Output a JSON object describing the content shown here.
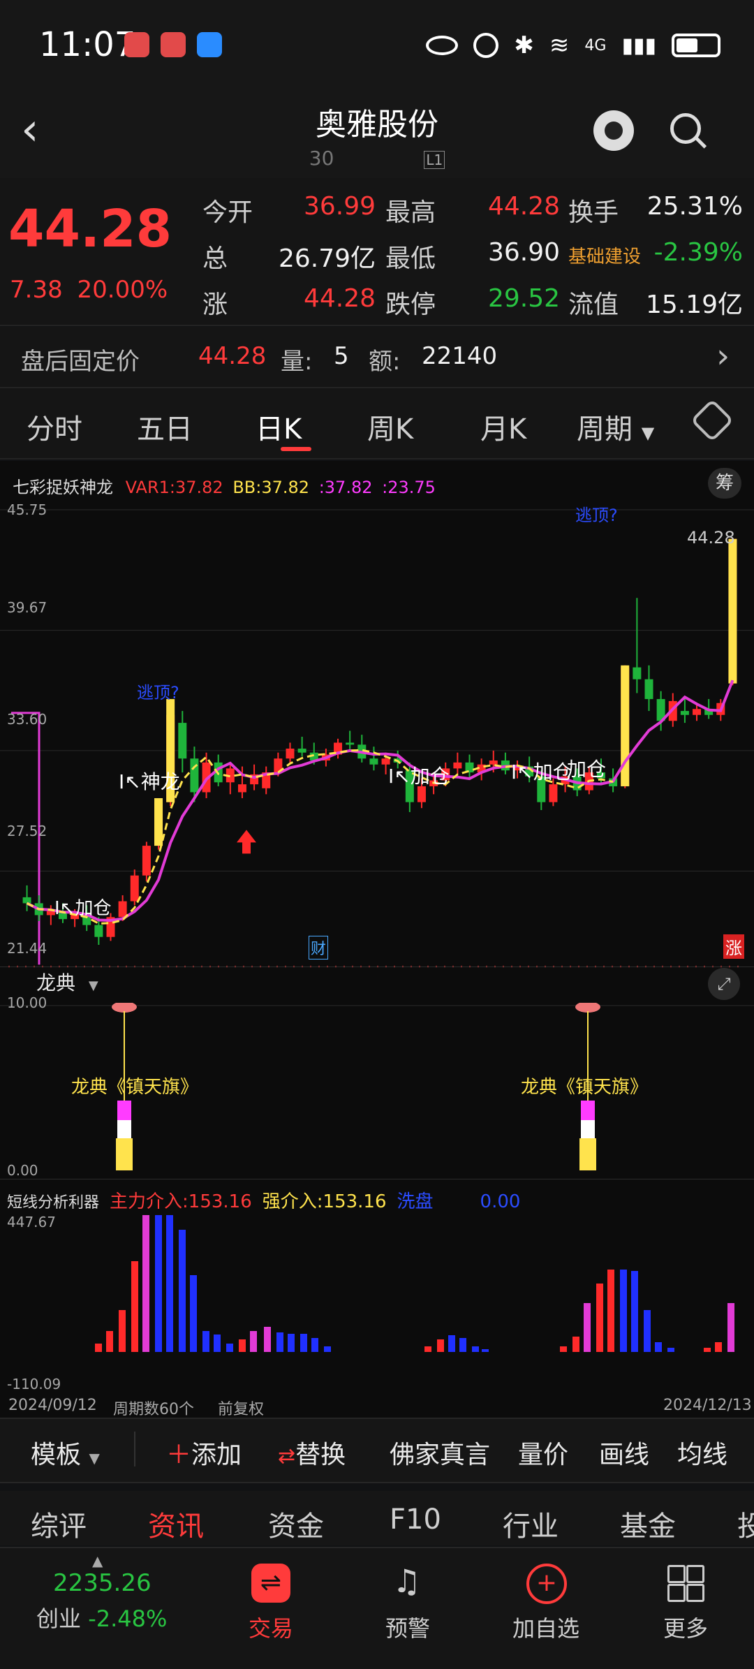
{
  "status_bar": {
    "time": "11:07",
    "network": "4G",
    "app_icon_label": "HUAWEI"
  },
  "header": {
    "title": "奥雅股份",
    "subtitle": "30",
    "badge": "L1"
  },
  "quote": {
    "price": "44.28",
    "change": "7.38",
    "change_pct": "20.00%",
    "fields": [
      {
        "label": "今开",
        "value": "36.99",
        "color": "red"
      },
      {
        "label": "最高",
        "value": "44.28",
        "color": "red"
      },
      {
        "label": "换手",
        "value": "25.31%",
        "color": "white"
      },
      {
        "label": "总",
        "value": "26.79亿",
        "color": "white"
      },
      {
        "label": "最低",
        "value": "36.90",
        "color": "white"
      },
      {
        "label": "基础建设",
        "value": "-2.39%",
        "color": "green"
      },
      {
        "label": "涨",
        "value": "44.28",
        "color": "red"
      },
      {
        "label": "跌停",
        "value": "29.52",
        "color": "green"
      },
      {
        "label": "流值",
        "value": "15.19亿",
        "color": "white"
      }
    ]
  },
  "after_hours": {
    "label": "盘后固定价",
    "price": "44.28",
    "vol_label": "量:",
    "vol": "5",
    "amt_label": "额:",
    "amt": "22140"
  },
  "period_tabs": [
    "分时",
    "五日",
    "日K",
    "周K",
    "月K",
    "周期"
  ],
  "main_chart": {
    "indicator_name": "七彩捉妖神龙",
    "var1": "VAR1:37.82",
    "bb": "BB:37.82",
    "v3": ":37.82",
    "v4": ":23.75",
    "chip_button": "筹",
    "y_labels": [
      "45.75",
      "39.67",
      "33.60",
      "27.52",
      "21.44"
    ],
    "last_price_tag": "44.28",
    "annotations": [
      "逃顶?",
      "逃顶?",
      "神龙",
      "加仓",
      "加仓",
      "加仓",
      "加仓",
      "加仓"
    ],
    "finance_marker": "财",
    "limit_up_marker": "涨",
    "colors": {
      "up": "#ff2a2a",
      "down": "#1fb43b",
      "ma_yellow": "#ffe34d",
      "ma_magenta": "#e23bd6"
    }
  },
  "chart_data": {
    "type": "candlestick",
    "ylim": [
      21.44,
      45.75
    ],
    "x_start": "2024/09/12",
    "x_end": "2024/12/13",
    "count": 60,
    "ohlc": [
      [
        26.2,
        26.8,
        25.5,
        25.9
      ],
      [
        25.9,
        26.3,
        25.0,
        25.3
      ],
      [
        25.3,
        25.8,
        24.8,
        25.5
      ],
      [
        25.5,
        25.9,
        24.9,
        25.1
      ],
      [
        25.1,
        25.6,
        24.7,
        25.4
      ],
      [
        25.4,
        25.8,
        24.5,
        24.8
      ],
      [
        24.8,
        25.2,
        23.8,
        24.2
      ],
      [
        24.2,
        25.4,
        24.0,
        25.2
      ],
      [
        25.2,
        26.3,
        25.0,
        26.0
      ],
      [
        26.0,
        27.6,
        25.8,
        27.3
      ],
      [
        27.3,
        29.0,
        27.0,
        28.8
      ],
      [
        28.8,
        31.2,
        28.6,
        31.0
      ],
      [
        31.0,
        36.2,
        30.8,
        35.4
      ],
      [
        35.0,
        35.6,
        32.5,
        33.2
      ],
      [
        33.2,
        33.8,
        31.0,
        31.5
      ],
      [
        31.5,
        33.5,
        31.2,
        33.0
      ],
      [
        33.0,
        33.4,
        31.8,
        32.0
      ],
      [
        32.0,
        33.0,
        31.4,
        32.7
      ],
      [
        31.5,
        32.8,
        31.2,
        31.9
      ],
      [
        31.9,
        32.9,
        31.6,
        32.4
      ],
      [
        31.7,
        32.8,
        31.4,
        32.5
      ],
      [
        32.5,
        33.5,
        32.3,
        33.2
      ],
      [
        33.2,
        34.0,
        32.9,
        33.7
      ],
      [
        33.7,
        34.3,
        33.3,
        33.5
      ],
      [
        33.5,
        34.0,
        32.9,
        33.1
      ],
      [
        33.1,
        33.7,
        32.8,
        33.4
      ],
      [
        33.4,
        34.2,
        33.2,
        34.0
      ],
      [
        34.0,
        34.6,
        33.6,
        33.9
      ],
      [
        33.9,
        34.4,
        33.0,
        33.2
      ],
      [
        33.2,
        33.8,
        32.6,
        32.9
      ],
      [
        32.9,
        33.5,
        32.4,
        33.2
      ],
      [
        33.2,
        33.6,
        32.7,
        33.0
      ],
      [
        32.6,
        33.0,
        30.5,
        31.0
      ],
      [
        31.0,
        32.2,
        30.7,
        31.8
      ],
      [
        31.8,
        32.5,
        31.4,
        32.1
      ],
      [
        32.1,
        33.0,
        31.8,
        32.7
      ],
      [
        32.7,
        33.5,
        32.4,
        33.0
      ],
      [
        33.0,
        33.4,
        32.2,
        32.5
      ],
      [
        32.5,
        33.2,
        32.1,
        32.9
      ],
      [
        32.9,
        33.6,
        32.5,
        33.1
      ],
      [
        33.1,
        33.5,
        32.4,
        32.6
      ],
      [
        32.6,
        33.1,
        32.2,
        32.8
      ],
      [
        32.8,
        33.3,
        32.0,
        32.3
      ],
      [
        32.3,
        32.6,
        30.6,
        31.0
      ],
      [
        31.0,
        32.2,
        30.8,
        31.9
      ],
      [
        31.9,
        32.8,
        31.5,
        32.3
      ],
      [
        32.3,
        32.7,
        31.3,
        31.6
      ],
      [
        31.6,
        32.8,
        31.4,
        32.5
      ],
      [
        32.5,
        33.2,
        31.9,
        32.2
      ],
      [
        32.2,
        32.7,
        31.5,
        31.8
      ],
      [
        31.8,
        37.9,
        31.7,
        37.8
      ],
      [
        37.8,
        41.3,
        36.5,
        37.2
      ],
      [
        37.2,
        37.9,
        35.6,
        36.2
      ],
      [
        36.2,
        36.6,
        34.6,
        35.1
      ],
      [
        35.1,
        36.5,
        34.8,
        36.1
      ],
      [
        35.6,
        36.3,
        35.0,
        35.4
      ],
      [
        35.4,
        36.0,
        35.1,
        35.7
      ],
      [
        35.7,
        36.2,
        35.2,
        35.4
      ],
      [
        35.4,
        36.2,
        35.1,
        36.0
      ],
      [
        36.99,
        44.28,
        36.9,
        44.28
      ]
    ]
  },
  "longdian": {
    "name": "龙典",
    "y_top": "10.00",
    "y_bottom": "0.00",
    "signal_label": "龙典《镇天旗》"
  },
  "short_line": {
    "name": "短线分析利器",
    "zhuli": "主力介入:153.16",
    "qiang": "强介入:153.16",
    "xipan": "洗盘",
    "xipan_val": "0.00",
    "y_top": "447.67",
    "y_bottom": "-110.09"
  },
  "chart_footer": {
    "start_date": "2024/09/12",
    "period_count": "周期数60个",
    "adjust": "前复权",
    "end_date": "2024/12/13"
  },
  "toolbar": [
    "模板",
    "添加",
    "替换",
    "佛家真言",
    "量价",
    "画线",
    "均线"
  ],
  "info_tabs": [
    "综评",
    "资讯",
    "资金",
    "F10",
    "行业",
    "基金",
    "投"
  ],
  "bottom_nav": {
    "index_value": "2235.26",
    "index_name": "创业",
    "index_change": "-2.48%",
    "items": [
      "交易",
      "预警",
      "加自选",
      "更多"
    ]
  }
}
